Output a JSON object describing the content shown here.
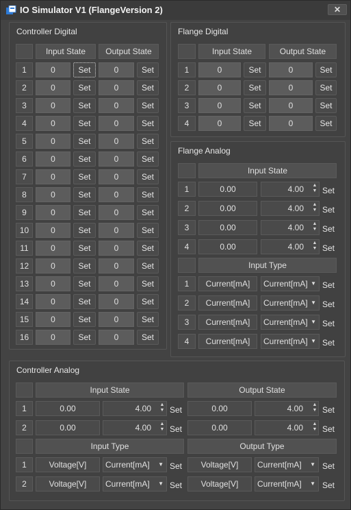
{
  "window": {
    "title": "IO Simulator V1 (FlangeVersion 2)",
    "close_label": "✕",
    "app_icon": "app-icon"
  },
  "controller_digital": {
    "title": "Controller Digital",
    "input_header": "Input State",
    "output_header": "Output State",
    "set_label": "Set",
    "rows": [
      {
        "index": "1",
        "input": "0",
        "output": "0"
      },
      {
        "index": "2",
        "input": "0",
        "output": "0"
      },
      {
        "index": "3",
        "input": "0",
        "output": "0"
      },
      {
        "index": "4",
        "input": "0",
        "output": "0"
      },
      {
        "index": "5",
        "input": "0",
        "output": "0"
      },
      {
        "index": "6",
        "input": "0",
        "output": "0"
      },
      {
        "index": "7",
        "input": "0",
        "output": "0"
      },
      {
        "index": "8",
        "input": "0",
        "output": "0"
      },
      {
        "index": "9",
        "input": "0",
        "output": "0"
      },
      {
        "index": "10",
        "input": "0",
        "output": "0"
      },
      {
        "index": "11",
        "input": "0",
        "output": "0"
      },
      {
        "index": "12",
        "input": "0",
        "output": "0"
      },
      {
        "index": "13",
        "input": "0",
        "output": "0"
      },
      {
        "index": "14",
        "input": "0",
        "output": "0"
      },
      {
        "index": "15",
        "input": "0",
        "output": "0"
      },
      {
        "index": "16",
        "input": "0",
        "output": "0"
      }
    ]
  },
  "flange_digital": {
    "title": "Flange Digital",
    "input_header": "Input State",
    "output_header": "Output State",
    "set_label": "Set",
    "rows": [
      {
        "index": "1",
        "input": "0",
        "output": "0"
      },
      {
        "index": "2",
        "input": "0",
        "output": "0"
      },
      {
        "index": "3",
        "input": "0",
        "output": "0"
      },
      {
        "index": "4",
        "input": "0",
        "output": "0"
      }
    ]
  },
  "flange_analog": {
    "title": "Flange Analog",
    "input_header": "Input State",
    "type_header": "Input Type",
    "set_label": "Set",
    "rows": [
      {
        "index": "1",
        "current": "0.00",
        "setpoint": "4.00"
      },
      {
        "index": "2",
        "current": "0.00",
        "setpoint": "4.00"
      },
      {
        "index": "3",
        "current": "0.00",
        "setpoint": "4.00"
      },
      {
        "index": "4",
        "current": "0.00",
        "setpoint": "4.00"
      }
    ],
    "type_rows": [
      {
        "index": "1",
        "current_type": "Current[mA]",
        "selected": "Current[mA]"
      },
      {
        "index": "2",
        "current_type": "Current[mA]",
        "selected": "Current[mA]"
      },
      {
        "index": "3",
        "current_type": "Current[mA]",
        "selected": "Current[mA]"
      },
      {
        "index": "4",
        "current_type": "Current[mA]",
        "selected": "Current[mA]"
      }
    ]
  },
  "controller_analog": {
    "title": "Controller Analog",
    "input_header": "Input State",
    "output_header": "Output State",
    "input_type_header": "Input Type",
    "output_type_header": "Output Type",
    "set_label": "Set",
    "state_rows": [
      {
        "index": "1",
        "in_current": "0.00",
        "in_set": "4.00",
        "out_current": "0.00",
        "out_set": "4.00"
      },
      {
        "index": "2",
        "in_current": "0.00",
        "in_set": "4.00",
        "out_current": "0.00",
        "out_set": "4.00"
      }
    ],
    "type_rows": [
      {
        "index": "1",
        "in_type": "Voltage[V]",
        "in_selected": "Current[mA]",
        "out_type": "Voltage[V]",
        "out_selected": "Current[mA]"
      },
      {
        "index": "2",
        "in_type": "Voltage[V]",
        "in_selected": "Current[mA]",
        "out_type": "Voltage[V]",
        "out_selected": "Current[mA]"
      }
    ]
  }
}
